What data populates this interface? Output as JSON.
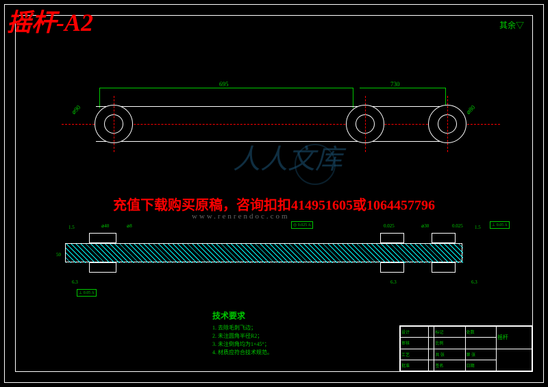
{
  "title": "摇杆-A2",
  "corner_text": "其余▽",
  "top_view": {
    "dim_left": "⌀90",
    "dim_span1": "695",
    "dim_span2": "730",
    "dim_right": "⌀80"
  },
  "overlay": {
    "red_text": "充值下载购买原稿，咨询扣扣414951605或1064457796",
    "url": "www.renrendoc.com"
  },
  "watermark": "人人文库",
  "section_view": {
    "dims_top": [
      "1.5",
      "⌀40",
      "⌀8",
      "0.025",
      "0.025",
      "⌀30",
      "0.025",
      "1.5",
      "0.05"
    ],
    "dims_left": [
      "50",
      "A"
    ],
    "dims_bottom": [
      "6.3",
      "0.05",
      "A",
      "6.3",
      "6.3"
    ],
    "tol_boxes": [
      "⊥ 0.05 A",
      "◎ 0.025 A"
    ]
  },
  "tech_req": {
    "title": "技术要求",
    "items": [
      "1. 去除毛刺飞边；",
      "2. 未注圆角半径R2；",
      "3. 未注倒角均为1×45°；",
      "4. 材质应符合技术规范。"
    ]
  },
  "title_block": {
    "part_name": "摇杆",
    "cells": [
      "设计",
      "审核",
      "工艺",
      "批准",
      "标记",
      "处数",
      "更改文件号",
      "签名",
      "日期",
      "比例",
      "共 张",
      "第 张"
    ]
  }
}
